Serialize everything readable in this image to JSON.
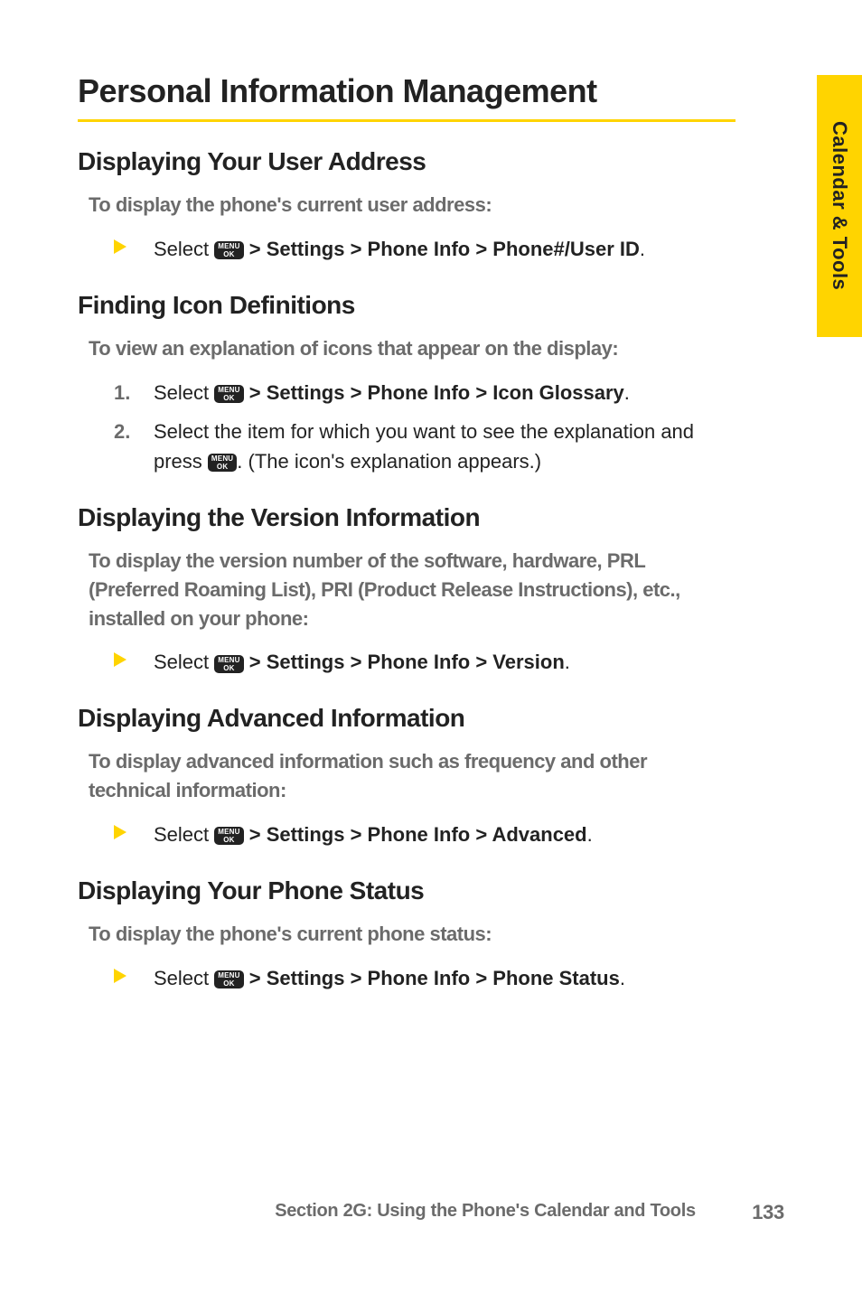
{
  "sideTab": "Calendar & Tools",
  "heading": "Personal Information Management",
  "sections": [
    {
      "title": "Displaying Your User Address",
      "lead": "To display the phone's current user address:",
      "items": [
        {
          "kind": "bullet",
          "before": "Select ",
          "bold": " > Settings > Phone Info > Phone#/User ID",
          "after": "."
        }
      ]
    },
    {
      "title": "Finding Icon Definitions",
      "lead": "To view an explanation of icons that appear on the display:",
      "items": [
        {
          "kind": "num",
          "num": "1.",
          "before": "Select ",
          "bold": " > Settings > Phone Info > Icon Glossary",
          "after": "."
        },
        {
          "kind": "num",
          "num": "2.",
          "before": "Select the item for which you want to see the explanation and press ",
          "bold": "",
          "after": ". (The icon's explanation appears.)"
        }
      ]
    },
    {
      "title": "Displaying the Version Information",
      "lead": "To display the version number of the software, hardware, PRL (Preferred Roaming List), PRI (Product Release Instructions), etc., installed on your phone:",
      "items": [
        {
          "kind": "bullet",
          "before": "Select ",
          "bold": " > Settings > Phone Info > Version",
          "after": "."
        }
      ]
    },
    {
      "title": "Displaying Advanced Information",
      "lead": "To display advanced information such as frequency and other technical information:",
      "items": [
        {
          "kind": "bullet",
          "before": "Select ",
          "bold": " > Settings > Phone Info > Advanced",
          "after": "."
        }
      ]
    },
    {
      "title": "Displaying Your Phone Status",
      "lead": "To display the phone's current phone status:",
      "items": [
        {
          "kind": "bullet",
          "before": "Select ",
          "bold": " > Settings > Phone Info > Phone Status",
          "after": "."
        }
      ]
    }
  ],
  "menuKey": {
    "top": "MENU",
    "bottom": "OK"
  },
  "footer": {
    "text": "Section 2G: Using the Phone's Calendar and Tools",
    "page": "133"
  }
}
